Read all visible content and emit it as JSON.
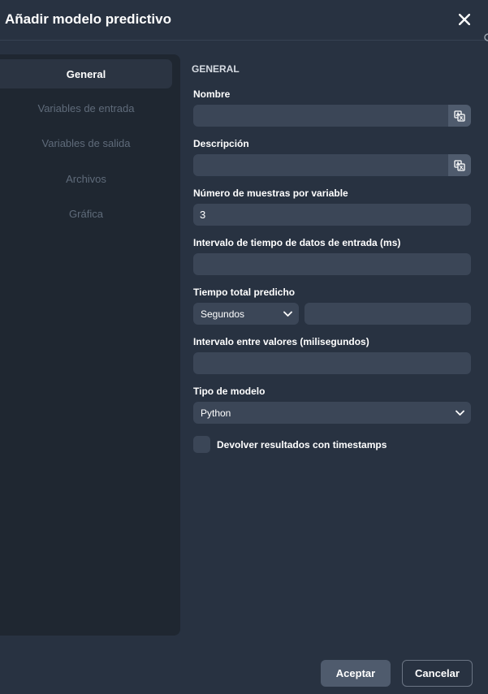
{
  "dialog": {
    "title": "Añadir modelo predictivo"
  },
  "sidebar": {
    "items": [
      {
        "label": "General",
        "active": true
      },
      {
        "label": "Variables de entrada",
        "active": false
      },
      {
        "label": "Variables de salida",
        "active": false
      },
      {
        "label": "Archivos",
        "active": false
      },
      {
        "label": "Gráfica",
        "active": false
      }
    ]
  },
  "form": {
    "section_title": "GENERAL",
    "nombre": {
      "label": "Nombre",
      "value": ""
    },
    "descripcion": {
      "label": "Descripción",
      "value": ""
    },
    "muestras": {
      "label": "Número de muestras por variable",
      "value": "3"
    },
    "intervalo_entrada": {
      "label": "Intervalo de tiempo de datos de entrada (ms)",
      "value": ""
    },
    "tiempo_total": {
      "label": "Tiempo total predicho",
      "unit": "Segundos",
      "value": ""
    },
    "intervalo_valores": {
      "label": "Intervalo entre valores (milisegundos)",
      "value": ""
    },
    "tipo_modelo": {
      "label": "Tipo de modelo",
      "value": "Python"
    },
    "timestamps": {
      "label": "Devolver resultados con timestamps",
      "checked": false
    }
  },
  "footer": {
    "accept_label": "Aceptar",
    "cancel_label": "Cancelar"
  },
  "colors": {
    "background": "#283241",
    "sidebar": "#1f2731",
    "input": "#3b4657",
    "button": "#4f5b6d"
  }
}
